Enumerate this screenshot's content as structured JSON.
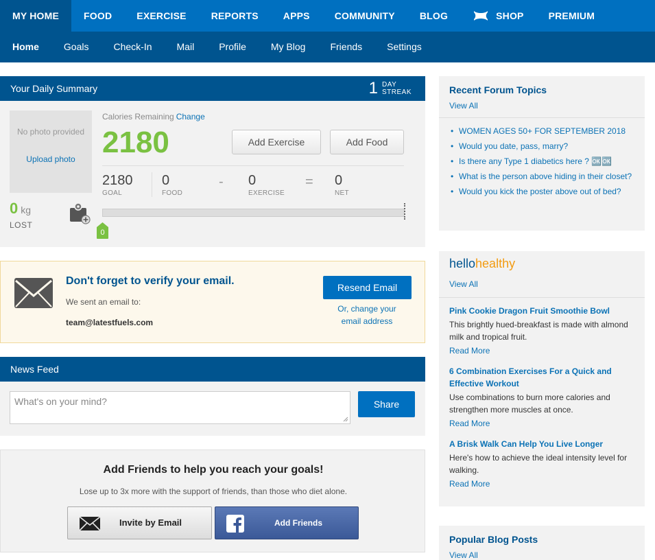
{
  "topnav": {
    "items": [
      "MY HOME",
      "FOOD",
      "EXERCISE",
      "REPORTS",
      "APPS",
      "COMMUNITY",
      "BLOG",
      "SHOP",
      "PREMIUM"
    ]
  },
  "subnav": {
    "items": [
      "Home",
      "Goals",
      "Check-In",
      "Mail",
      "Profile",
      "My Blog",
      "Friends",
      "Settings"
    ]
  },
  "summary": {
    "title": "Your Daily Summary",
    "streak_count": "1",
    "streak_label_1": "DAY",
    "streak_label_2": "STREAK",
    "no_photo": "No photo provided",
    "upload_photo": "Upload photo",
    "lost_value": "0",
    "lost_unit": "kg",
    "lost_label": "LOST",
    "calories_remaining_label": "Calories Remaining",
    "change_link": "Change",
    "calories_remaining": "2180",
    "add_exercise": "Add Exercise",
    "add_food": "Add Food",
    "goal_value": "2180",
    "goal_label": "GOAL",
    "food_value": "0",
    "food_label": "FOOD",
    "minus": "-",
    "exercise_value": "0",
    "exercise_label": "EXERCISE",
    "equals": "=",
    "net_value": "0",
    "net_label": "NET",
    "progress_marker": "0",
    "progress_fraction": 0
  },
  "verify": {
    "title": "Don't forget to verify your email.",
    "sent_text": "We sent an email to:",
    "email": "team@latestfuels.com",
    "resend_button": "Resend Email",
    "change_line_1": "Or, change your",
    "change_line_2": "email address"
  },
  "news": {
    "title": "News Feed",
    "placeholder": "What's on your mind?",
    "share_button": "Share"
  },
  "friends": {
    "title": "Add Friends to help you reach your goals!",
    "subtitle": "Lose up to 3x more with the support of friends, than those who diet alone.",
    "invite_button": "Invite by Email",
    "facebook_button": "Add Friends"
  },
  "forum": {
    "title": "Recent Forum Topics",
    "view_all": "View All",
    "topics": [
      "WOMEN AGES 50+ FOR SEPTEMBER 2018",
      "Would you date, pass, marry?",
      "Is there any Type 1 diabetics here ? 🆗🆗",
      "What is the person above hiding in their closet?",
      "Would you kick the poster above out of bed?"
    ]
  },
  "hellohealthy": {
    "logo_a": "hello",
    "logo_b": "healthy",
    "view_all": "View All",
    "articles": [
      {
        "title": "Pink Cookie Dragon Fruit Smoothie Bowl",
        "desc": "This brightly hued-breakfast is made with almond milk and tropical fruit.",
        "read_more": "Read More"
      },
      {
        "title": "6 Combination Exercises For a Quick and Effective Workout",
        "desc": "Use combinations to burn more calories and strengthen more muscles at once.",
        "read_more": "Read More"
      },
      {
        "title": "A Brisk Walk Can Help You Live Longer",
        "desc": "Here's how to achieve the ideal intensity level for walking.",
        "read_more": "Read More"
      }
    ]
  },
  "blog": {
    "title": "Popular Blog Posts",
    "view_all": "View All"
  },
  "colors": {
    "nav_blue": "#0070c0",
    "dark_blue": "#00548f",
    "green": "#7ac142",
    "link": "#0b72b5"
  }
}
